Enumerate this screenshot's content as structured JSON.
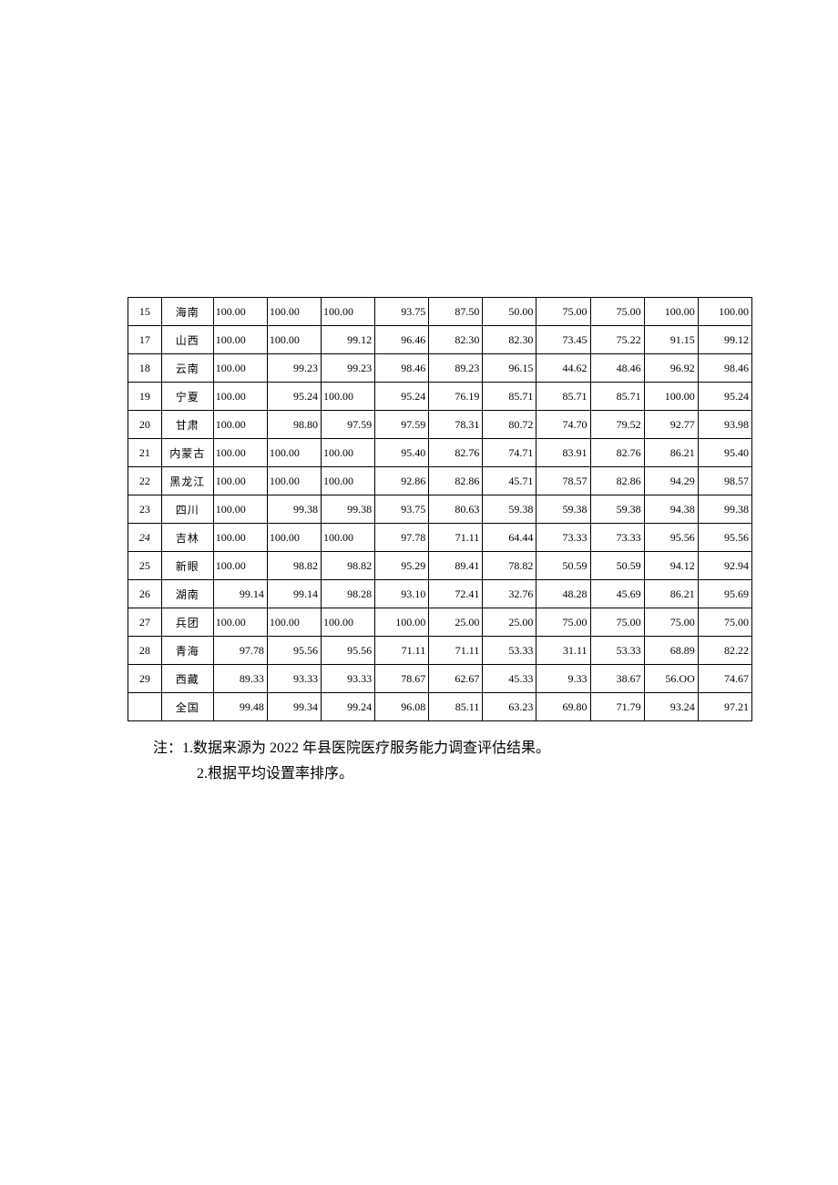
{
  "table": {
    "rows": [
      {
        "rank": "15",
        "prov": "海南",
        "c3": "100.00",
        "c4": "100.00",
        "c5": "100.00",
        "c6": "93.75",
        "c7": "87.50",
        "c8": "50.00",
        "c9": "75.00",
        "c10": "75.00",
        "c11": "100.00",
        "c12": "100.00",
        "align": {
          "c3": "l",
          "c4": "l",
          "c5": "l"
        }
      },
      {
        "rank": "17",
        "prov": "山西",
        "c3": "100.00",
        "c4": "100.00",
        "c5": "99.12",
        "c6": "96.46",
        "c7": "82.30",
        "c8": "82.30",
        "c9": "73.45",
        "c10": "75.22",
        "c11": "91.15",
        "c12": "99.12",
        "align": {
          "c3": "l",
          "c4": "l"
        }
      },
      {
        "rank": "18",
        "prov": "云南",
        "c3": "100.00",
        "c4": "99.23",
        "c5": "99.23",
        "c6": "98.46",
        "c7": "89.23",
        "c8": "96.15",
        "c9": "44.62",
        "c10": "48.46",
        "c11": "96.92",
        "c12": "98.46",
        "align": {
          "c3": "l"
        }
      },
      {
        "rank": "19",
        "prov": "宁夏",
        "c3": "100.00",
        "c4": "95.24",
        "c5": "100.00",
        "c6": "95.24",
        "c7": "76.19",
        "c8": "85.71",
        "c9": "85.71",
        "c10": "85.71",
        "c11": "100.00",
        "c12": "95.24",
        "align": {
          "c3": "l",
          "c5": "l"
        }
      },
      {
        "rank": "20",
        "prov": "甘肃",
        "c3": "100.00",
        "c4": "98.80",
        "c5": "97.59",
        "c6": "97.59",
        "c7": "78.31",
        "c8": "80.72",
        "c9": "74.70",
        "c10": "79.52",
        "c11": "92.77",
        "c12": "93.98",
        "align": {
          "c3": "l"
        }
      },
      {
        "rank": "21",
        "prov": "内蒙古",
        "c3": "100.00",
        "c4": "100.00",
        "c5": "100.00",
        "c6": "95.40",
        "c7": "82.76",
        "c8": "74.71",
        "c9": "83.91",
        "c10": "82.76",
        "c11": "86.21",
        "c12": "95.40",
        "align": {
          "c3": "l",
          "c4": "l",
          "c5": "l"
        }
      },
      {
        "rank": "22",
        "prov": "黑龙江",
        "c3": "100.00",
        "c4": "100.00",
        "c5": "100.00",
        "c6": "92.86",
        "c7": "82.86",
        "c8": "45.71",
        "c9": "78.57",
        "c10": "82.86",
        "c11": "94.29",
        "c12": "98.57",
        "align": {
          "c3": "l",
          "c4": "l",
          "c5": "l"
        }
      },
      {
        "rank": "23",
        "prov": "四川",
        "c3": "100.00",
        "c4": "99.38",
        "c5": "99.38",
        "c6": "93.75",
        "c7": "80.63",
        "c8": "59.38",
        "c9": "59.38",
        "c10": "59.38",
        "c11": "94.38",
        "c12": "99.38",
        "align": {
          "c3": "l"
        }
      },
      {
        "rank": "24",
        "prov": "吉林",
        "c3": "100.00",
        "c4": "100.00",
        "c5": "100.00",
        "c6": "97.78",
        "c7": "71.11",
        "c8": "64.44",
        "c9": "73.33",
        "c10": "73.33",
        "c11": "95.56",
        "c12": "95.56",
        "align": {
          "c3": "l",
          "c4": "l",
          "c5": "l"
        },
        "italic": true
      },
      {
        "rank": "25",
        "prov": "新眼",
        "c3": "100.00",
        "c4": "98.82",
        "c5": "98.82",
        "c6": "95.29",
        "c7": "89.41",
        "c8": "78.82",
        "c9": "50.59",
        "c10": "50.59",
        "c11": "94.12",
        "c12": "92.94",
        "align": {
          "c3": "l"
        }
      },
      {
        "rank": "26",
        "prov": "湖南",
        "c3": "99.14",
        "c4": "99.14",
        "c5": "98.28",
        "c6": "93.10",
        "c7": "72.41",
        "c8": "32.76",
        "c9": "48.28",
        "c10": "45.69",
        "c11": "86.21",
        "c12": "95.69"
      },
      {
        "rank": "27",
        "prov": "兵团",
        "c3": "100.00",
        "c4": "100.00",
        "c5": "100.00",
        "c6": "100.00",
        "c7": "25.00",
        "c8": "25.00",
        "c9": "75.00",
        "c10": "75.00",
        "c11": "75.00",
        "c12": "75.00",
        "align": {
          "c3": "l",
          "c4": "l",
          "c5": "l"
        }
      },
      {
        "rank": "28",
        "prov": "青海",
        "c3": "97.78",
        "c4": "95.56",
        "c5": "95.56",
        "c6": "71.11",
        "c7": "71.11",
        "c8": "53.33",
        "c9": "31.11",
        "c10": "53.33",
        "c11": "68.89",
        "c12": "82.22"
      },
      {
        "rank": "29",
        "prov": "西藏",
        "c3": "89.33",
        "c4": "93.33",
        "c5": "93.33",
        "c6": "78.67",
        "c7": "62.67",
        "c8": "45.33",
        "c9": "9.33",
        "c10": "38.67",
        "c11": "56.OO",
        "c12": "74.67"
      },
      {
        "rank": "",
        "prov": "全国",
        "c3": "99.48",
        "c4": "99.34",
        "c5": "99.24",
        "c6": "96.08",
        "c7": "85.11",
        "c8": "63.23",
        "c9": "69.80",
        "c10": "71.79",
        "c11": "93.24",
        "c12": "97.21"
      }
    ]
  },
  "notes": {
    "line1": "注：1.数据来源为 2022 年县医院医疗服务能力调查评估结果。",
    "line2": "2.根据平均设置率排序。"
  }
}
